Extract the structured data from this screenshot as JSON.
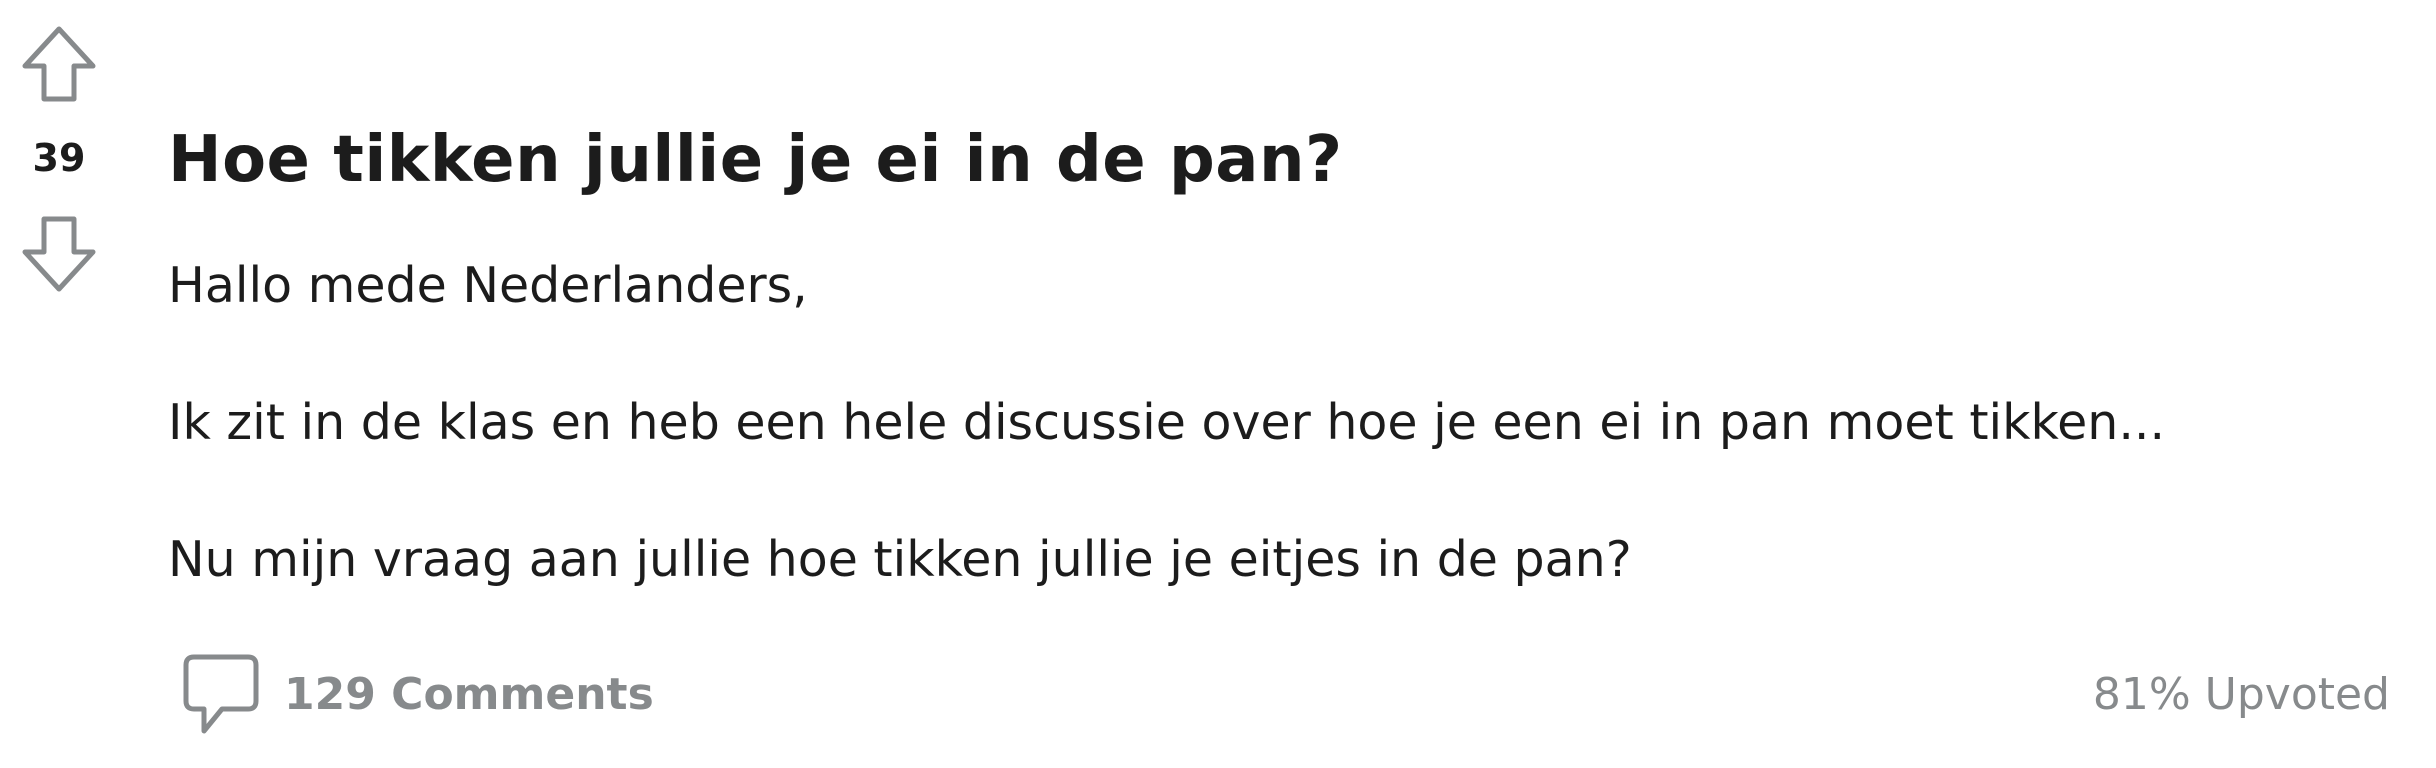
{
  "post": {
    "score": "39",
    "title": "Hoe tikken jullie je ei in de pan?",
    "paragraphs": [
      "Hallo mede Nederlanders,",
      "Ik zit in de klas en heb een hele discussie over hoe je een ei in pan moet tikken...",
      "Nu mijn vraag aan jullie hoe tikken jullie je eitjes in de pan?"
    ],
    "comments_label": "129 Comments",
    "upvoted_label": "81% Upvoted"
  },
  "icons": {
    "upvote": "arrow-up-outline-icon",
    "downvote": "arrow-down-outline-icon",
    "comments": "speech-bubble-icon"
  },
  "colors": {
    "text": "#1c1c1c",
    "muted": "#878a8c",
    "icon_stroke": "#878a8c"
  }
}
